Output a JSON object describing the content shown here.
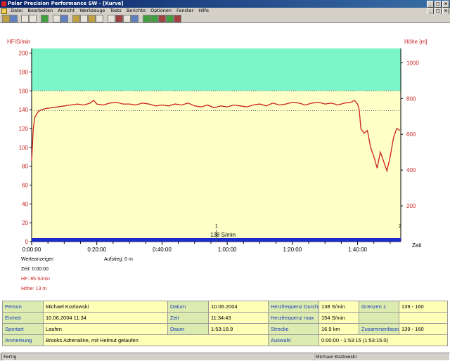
{
  "window": {
    "title": "Polar Precision Performance SW - [Kurve]"
  },
  "menu": [
    "Datei",
    "Bearbeiten",
    "Ansicht",
    "Werkzeuge",
    "Tests",
    "Berichte",
    "Optionen",
    "Fenster",
    "Hilfe"
  ],
  "chart_data": {
    "type": "line",
    "ylabel_left": "HF/S/min",
    "ylabel_right": "Höhe [m]",
    "xlabel": "Zeit",
    "yticks_left": [
      0,
      20,
      40,
      60,
      80,
      100,
      120,
      140,
      160,
      180,
      200
    ],
    "yticks_right": [
      200,
      400,
      600,
      800,
      1000
    ],
    "xticks": [
      "0:00:00",
      "0:20:00",
      "0:40:00",
      "1:00:00",
      "1:20:00",
      "1:40:00"
    ],
    "ylim_left": [
      0,
      205
    ],
    "xlim_minutes": [
      0,
      113.25
    ],
    "limits": [
      139,
      160
    ],
    "series": [
      {
        "name": "HF",
        "unit": "S/min",
        "color": "#cc2020",
        "x_minutes": [
          0,
          0.5,
          1,
          2,
          3,
          4,
          6,
          8,
          10,
          12,
          14,
          16,
          18,
          19,
          20,
          22,
          24,
          26,
          28,
          30,
          32,
          34,
          36,
          38,
          40,
          42,
          44,
          46,
          48,
          50,
          52,
          54,
          56,
          58,
          60,
          62,
          64,
          66,
          68,
          70,
          72,
          74,
          76,
          78,
          80,
          82,
          84,
          86,
          88,
          90,
          92,
          94,
          96,
          98,
          99,
          100,
          100.5,
          101,
          102,
          103,
          104,
          105,
          106,
          107,
          108,
          109,
          110,
          111,
          112,
          113
        ],
        "values": [
          85,
          120,
          132,
          138,
          140,
          141,
          142,
          143,
          144,
          145,
          146,
          145,
          147,
          150,
          146,
          145,
          147,
          148,
          146,
          146,
          145,
          147,
          146,
          144,
          145,
          144,
          146,
          145,
          147,
          144,
          143,
          145,
          142,
          144,
          143,
          145,
          144,
          143,
          145,
          146,
          144,
          147,
          145,
          146,
          148,
          147,
          145,
          147,
          148,
          146,
          147,
          145,
          147,
          148,
          150,
          146,
          140,
          120,
          115,
          118,
          100,
          90,
          78,
          95,
          85,
          75,
          90,
          110,
          120,
          118
        ]
      }
    ],
    "marker_label": "138 S/min",
    "lap_markers": [
      "1",
      "2"
    ]
  },
  "werteanzeiger": {
    "title": "Werteanzeiger:",
    "aufstieg": "Aufstieg: 0 m",
    "zeit": "Zeit: 0:00:00",
    "hf": "HF: 85 S/min",
    "hoehe": "Höhe: 13 m"
  },
  "summary": {
    "rows": [
      [
        "Person",
        "Michael Kozlowski",
        "Datum",
        "10.06.2004",
        "Herzfrequenz Durchschn.",
        "138 S/min",
        "Grenzen 1",
        "139 - 160"
      ],
      [
        "Einheit",
        "10.06.2004 11:34",
        "Zeit",
        "11:34:43",
        "Herzfrequenz max",
        "154 S/min",
        "",
        ""
      ],
      [
        "Sportart",
        "Laufen",
        "Dauer",
        "1:53:18.9",
        "Strecke",
        "16.9 km",
        "Zusammenfassung",
        "139 - 160"
      ]
    ],
    "last_row": [
      "Anmerkung",
      "Brooks Adrenaline, mit Helmut gelaufen",
      "Auswahl",
      "0:00:00 - 1:53:15 (1:53:15.0)"
    ]
  },
  "status": {
    "left": "Fertig",
    "right": "Michael Kozlowski"
  },
  "colors": {
    "above_limit": "#7cf5c8",
    "below_limit": "#ffffc8",
    "hf_line": "#cc2020",
    "bottom_bar": "#1a2ccc"
  }
}
